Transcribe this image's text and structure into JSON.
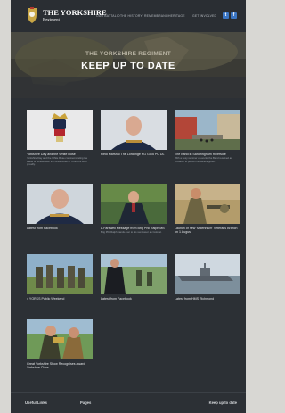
{
  "brand": {
    "name": "THE YORKSHIRE",
    "sub": "Regiment"
  },
  "nav": [
    "Our Battalion",
    "The History",
    "Remembrance",
    "Heritage",
    "Get Involved"
  ],
  "social": [
    "t",
    "f"
  ],
  "hero": {
    "subtitle": "The Yorkshire Regiment",
    "title": "KEEP UP TO DATE"
  },
  "cards": [
    {
      "caption": "Yorkshire Day and the White Rose",
      "desc": "Yorkshire Day and the White Rose commemorating the Battle of Minden with the White Rose of Yorkshire worn proudly."
    },
    {
      "caption": "Field Marshal The Lord Inge KG GCB PC DL",
      "desc": ""
    },
    {
      "caption": "The Band in Sandringham Riverside",
      "desc": "With a busy summer of events the Band received an invitation to perform at Sandringham."
    },
    {
      "caption": "Latest from Facebook",
      "desc": ""
    },
    {
      "caption": "A Farewell Message from Brig Phil Ralph MB",
      "desc": "Brig Phil Ralph hands over to his successor as Colonel."
    },
    {
      "caption": "Launch of new 'Millennium' Veterans Branch on 1 August",
      "desc": ""
    },
    {
      "caption": "4 YORKS Public Weekend",
      "desc": ""
    },
    {
      "caption": "Latest from Facebook",
      "desc": ""
    },
    {
      "caption": "Latest from HMS Richmond",
      "desc": ""
    },
    {
      "caption": "Great Yorkshire Show Recognises award Yorkshire Class",
      "desc": ""
    }
  ],
  "footer": {
    "useful_links": "Useful Links",
    "pages": "Pages",
    "keep_up": "Keep up to date"
  }
}
